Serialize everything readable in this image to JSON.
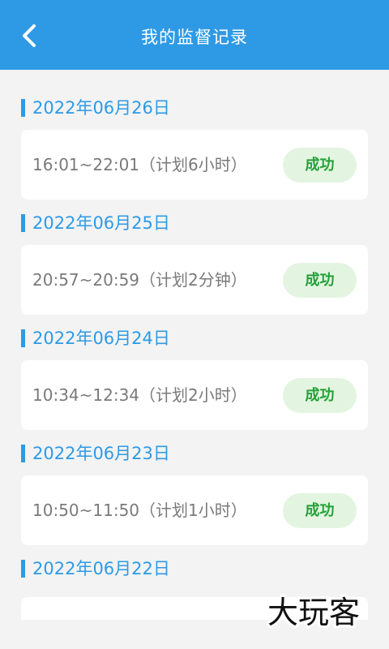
{
  "header": {
    "title": "我的监督记录",
    "back_icon": "chevron-left-icon",
    "bg_color": "#2e9ae6"
  },
  "records": [
    {
      "date": "2022年06月26日",
      "time": "16:01~22:01（计划6小时）",
      "status": "成功"
    },
    {
      "date": "2022年06月25日",
      "time": "20:57~20:59（计划2分钟）",
      "status": "成功"
    },
    {
      "date": "2022年06月24日",
      "time": "10:34~12:34（计划2小时）",
      "status": "成功"
    },
    {
      "date": "2022年06月23日",
      "time": "10:50~11:50（计划1小时）",
      "status": "成功"
    },
    {
      "date": "2022年06月22日"
    }
  ],
  "colors": {
    "accent": "#2e9ae6",
    "success_text": "#27a03a",
    "success_bg": "#e3f5e1",
    "page_bg": "#f3f3f3"
  },
  "watermark": "大玩客"
}
